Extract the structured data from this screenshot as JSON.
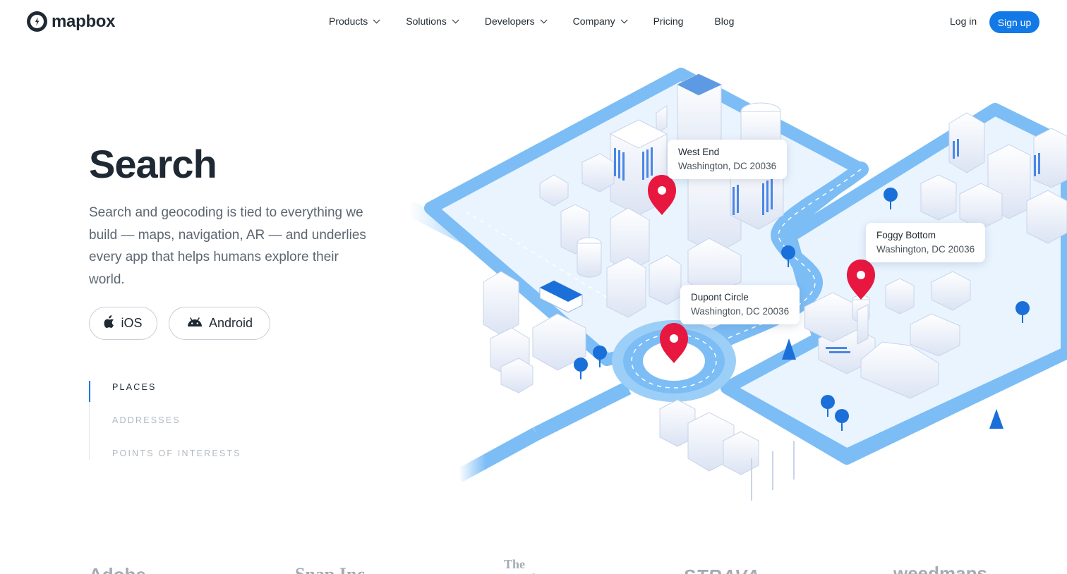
{
  "brand": {
    "name": "mapbox",
    "accent_color": "#1279e6",
    "text_color": "#1f2933"
  },
  "nav": {
    "items": [
      {
        "label": "Products",
        "has_dropdown": true
      },
      {
        "label": "Solutions",
        "has_dropdown": true
      },
      {
        "label": "Developers",
        "has_dropdown": true
      },
      {
        "label": "Company",
        "has_dropdown": true
      },
      {
        "label": "Pricing",
        "has_dropdown": false
      },
      {
        "label": "Blog",
        "has_dropdown": false
      }
    ],
    "login_label": "Log in",
    "signup_label": "Sign up"
  },
  "hero": {
    "title": "Search",
    "description": "Search and geocoding is tied to everything we build — maps, navigation, AR — and underlies every app that helps humans explore their world.",
    "buttons": [
      {
        "label": "iOS",
        "icon": "apple-icon"
      },
      {
        "label": "Android",
        "icon": "android-icon"
      }
    ],
    "tabs": [
      {
        "label": "PLACES",
        "active": true
      },
      {
        "label": "ADDRESSES",
        "active": false
      },
      {
        "label": "POINTS OF INTERESTS",
        "active": false
      }
    ]
  },
  "map": {
    "callouts": [
      {
        "name": "West End",
        "address": "Washington, DC 20036"
      },
      {
        "name": "Foggy Bottom",
        "address": "Washington, DC 20036"
      },
      {
        "name": "Dupont Circle",
        "address": "Washington, DC 20036"
      }
    ],
    "pin_color": "#e8173f",
    "road_color": "#7cbdf5",
    "ground_color": "#e9f4fe"
  },
  "customer_logos": [
    "Adobe",
    "Snap Inc.",
    "The Weather",
    "STRAVA",
    "weedmaps"
  ]
}
